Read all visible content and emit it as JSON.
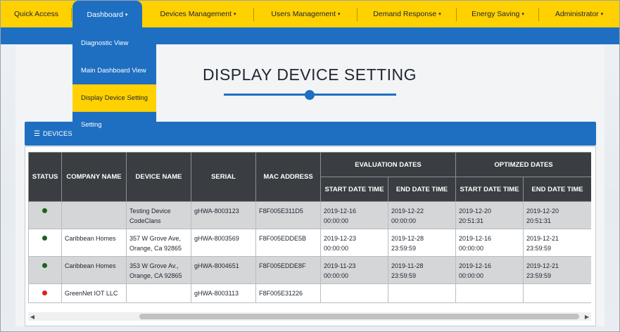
{
  "nav": {
    "items": [
      {
        "label": "Quick Access",
        "caret": ""
      },
      {
        "label": "Dashboard",
        "caret": "▾"
      },
      {
        "label": "Devices Management",
        "caret": "▾"
      },
      {
        "label": "Users Management",
        "caret": "▾"
      },
      {
        "label": "Demand Response",
        "caret": "▾"
      },
      {
        "label": "Energy Saving",
        "caret": "▾"
      },
      {
        "label": "Administrator",
        "caret": "▾"
      }
    ]
  },
  "dropdown": {
    "items": [
      {
        "label": "Diagnostic View"
      },
      {
        "label": "Main Dashboard View"
      },
      {
        "label": "Display Device Setting"
      },
      {
        "label": "Setting"
      }
    ]
  },
  "page": {
    "title": "DISPLAY DEVICE SETTING",
    "card_title": "DEVICES L"
  },
  "table": {
    "headers": {
      "status": "STATUS",
      "company": "COMPANY NAME",
      "device": "DEVICE NAME",
      "serial": "SERIAL",
      "mac": "MAC ADDRESS",
      "evaluation": "EVALUATION DATES",
      "optimized": "OPTIMZED DATES",
      "start": "START DATE TIME",
      "end": "END DATE TIME"
    },
    "rows": [
      {
        "status_color": "#1f5f1f",
        "company": "",
        "device_1": "Testing Device",
        "device_2": "CodeClans",
        "serial": "gHWA-8003123",
        "mac": "F8F005E311D5",
        "eval_start_1": "2019-12-16",
        "eval_start_2": "00:00:00",
        "eval_end_1": "2019-12-22",
        "eval_end_2": "00:00:00",
        "opt_start_1": "2019-12-20",
        "opt_start_2": "20:51:31",
        "opt_end_1": "2019-12-20",
        "opt_end_2": "20:51:31"
      },
      {
        "status_color": "#1f5f1f",
        "company": "Caribbean Homes",
        "device_1": "357 W Grove Ave,",
        "device_2": "Orange, Ca 92865",
        "serial": "gHWA-8003569",
        "mac": "F8F005EDDE5B",
        "eval_start_1": "2019-12-23",
        "eval_start_2": "00:00:00",
        "eval_end_1": "2019-12-28",
        "eval_end_2": "23:59:59",
        "opt_start_1": "2019-12-16",
        "opt_start_2": "00:00:00",
        "opt_end_1": "2019-12-21",
        "opt_end_2": "23:59:59"
      },
      {
        "status_color": "#1f5f1f",
        "company": "Caribbean Homes",
        "device_1": "353 W Grove Av.,",
        "device_2": "Orange, CA 92865",
        "serial": "gHWA-8004651",
        "mac": "F8F005EDDE8F",
        "eval_start_1": "2019-11-23",
        "eval_start_2": "00:00:00",
        "eval_end_1": "2019-11-28",
        "eval_end_2": "23:59:59",
        "opt_start_1": "2019-12-16",
        "opt_start_2": "00:00:00",
        "opt_end_1": "2019-12-21",
        "opt_end_2": "23:59:59"
      },
      {
        "status_color": "#e02020",
        "company": "GreenNet IOT LLC",
        "device_1": "",
        "device_2": "",
        "serial": "gHWA-8003113",
        "mac": "F8F005E31226",
        "eval_start_1": "",
        "eval_start_2": "",
        "eval_end_1": "",
        "eval_end_2": "",
        "opt_start_1": "",
        "opt_start_2": "",
        "opt_end_1": "",
        "opt_end_2": ""
      }
    ]
  },
  "scrollbar": {
    "left_arrow": "◀",
    "right_arrow": "▶"
  },
  "colors": {
    "nav": "#ffd100",
    "accent": "#1e6fc2",
    "header_bg": "#3a3d41",
    "active_status": "#1f5f1f",
    "inactive_status": "#e02020"
  }
}
